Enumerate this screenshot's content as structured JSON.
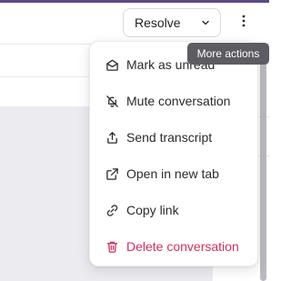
{
  "toolbar": {
    "resolve_label": "Resolve",
    "resolve_dropdown_icon": "chevron-down-icon",
    "more_icon": "more-vertical-icon"
  },
  "tooltip": {
    "text": "More actions"
  },
  "menu": {
    "items": [
      {
        "label": "Mark as unread",
        "icon": "mail-open-icon"
      },
      {
        "label": "Mute conversation",
        "icon": "bell-off-icon"
      },
      {
        "label": "Send transcript",
        "icon": "share-upload-icon"
      },
      {
        "label": "Open in new tab",
        "icon": "external-link-icon"
      },
      {
        "label": "Copy link",
        "icon": "link-icon"
      },
      {
        "label": "Delete conversation",
        "icon": "trash-icon",
        "danger": true
      }
    ]
  },
  "colors": {
    "accent_top": "#5b4a86",
    "danger": "#d12f5b",
    "tooltip_bg": "#5c5c62",
    "content_bg": "#ecebf0"
  }
}
